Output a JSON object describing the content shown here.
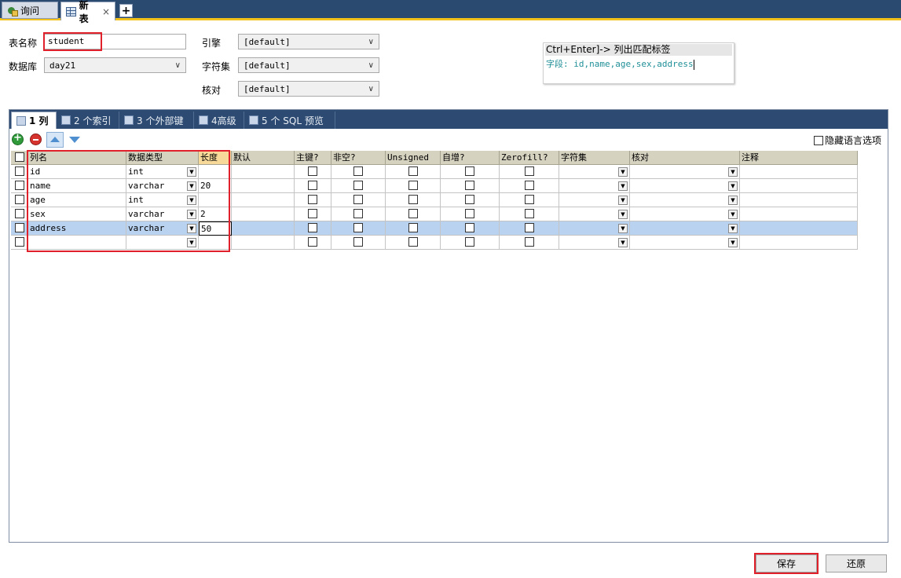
{
  "tabs": {
    "query_label": "询问",
    "newtable_label": "新表",
    "close_glyph": "×",
    "add_glyph": "+"
  },
  "form": {
    "table_name_label": "表名称",
    "table_name_value": "student",
    "database_label": "数据库",
    "database_value": "day21",
    "engine_label": "引擎",
    "engine_value": "[default]",
    "charset_label": "字符集",
    "charset_value": "[default]",
    "collation_label": "核对",
    "collation_value": "[default]"
  },
  "hint": {
    "title": "Ctrl+Enter]-> 列出匹配标签",
    "line": "字段: id,name,age,sex,address"
  },
  "subtabs": [
    {
      "label": "1 列"
    },
    {
      "label": "2 个索引"
    },
    {
      "label": "3 个外部键"
    },
    {
      "label": "4高级"
    },
    {
      "label": "5 个 SQL 预览"
    }
  ],
  "toolbar": {
    "hide_lang_label": "隐藏语言选项"
  },
  "columns": {
    "name": "列名",
    "datatype": "数据类型",
    "length": "长度",
    "default": "默认",
    "pk": "主键?",
    "notnull": "非空?",
    "unsigned": "Unsigned",
    "autoinc": "自增?",
    "zerofill": "Zerofill?",
    "charset": "字符集",
    "collation": "核对",
    "comment": "注释"
  },
  "rows": [
    {
      "name": "id",
      "type": "int",
      "length": ""
    },
    {
      "name": "name",
      "type": "varchar",
      "length": "20"
    },
    {
      "name": "age",
      "type": "int",
      "length": ""
    },
    {
      "name": "sex",
      "type": "varchar",
      "length": "2"
    },
    {
      "name": "address",
      "type": "varchar",
      "length": "50"
    },
    {
      "name": "",
      "type": "",
      "length": ""
    }
  ],
  "buttons": {
    "save_label": "保存",
    "revert_label": "还原"
  },
  "colors": {
    "highlight_red": "#e0202a",
    "selected_row": "#b9d2f0",
    "tab_bar": "#2b4a6f"
  }
}
